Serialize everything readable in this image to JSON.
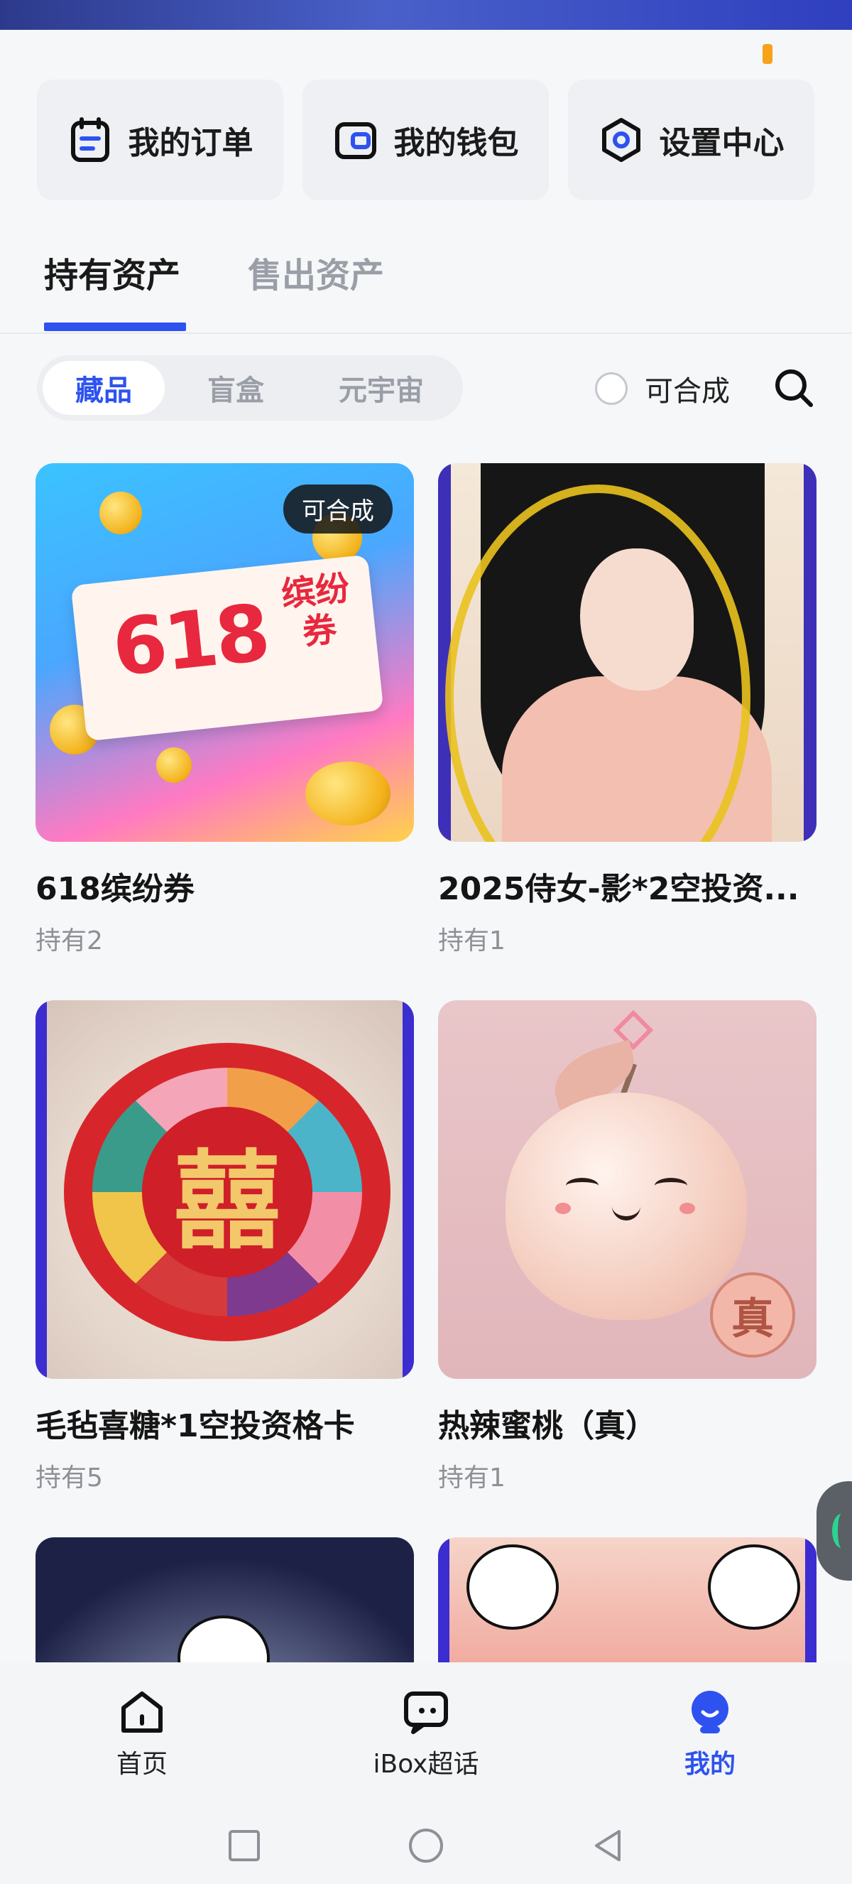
{
  "quick_actions": [
    {
      "label": "我的订单",
      "icon": "order-icon"
    },
    {
      "label": "我的钱包",
      "icon": "wallet-icon"
    },
    {
      "label": "设置中心",
      "icon": "settings-icon"
    }
  ],
  "tabs": [
    {
      "label": "持有资产",
      "active": true
    },
    {
      "label": "售出资产",
      "active": false
    }
  ],
  "filter": {
    "segments": [
      "藏品",
      "盲盒",
      "元宇宙"
    ],
    "active_segment": "藏品",
    "toggle_label": "可合成",
    "toggle_checked": false
  },
  "items": [
    {
      "title": "618缤纷券",
      "hold": "持有2",
      "badge": "可合成",
      "art_text": "618",
      "art_text_cn": "缤纷券"
    },
    {
      "title": "2025侍女-影*2空投资...",
      "hold": "持有1"
    },
    {
      "title": "毛毡喜糖*1空投资格卡",
      "hold": "持有5",
      "art_text": "囍"
    },
    {
      "title": "热辣蜜桃（真）",
      "hold": "持有1",
      "art_text": "真"
    },
    {
      "title": "",
      "hold": ""
    },
    {
      "title": "",
      "hold": ""
    }
  ],
  "bottom_nav": [
    {
      "label": "首页",
      "icon": "home-icon",
      "active": false
    },
    {
      "label": "iBox超话",
      "icon": "chat-icon",
      "active": false
    },
    {
      "label": "我的",
      "icon": "profile-icon",
      "active": true
    }
  ],
  "colors": {
    "accent": "#2d52f0",
    "badge_bg": "#141414",
    "orange_indicator": "#f6a21a"
  }
}
